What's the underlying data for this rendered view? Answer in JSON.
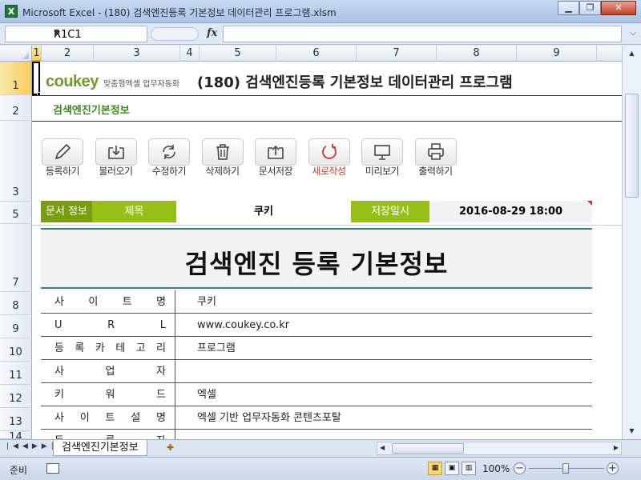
{
  "window": {
    "app_icon": "X",
    "title": "Microsoft Excel - (180) 검색엔진등록 기본정보 데이터관리 프로그램.xlsm",
    "min": "▁",
    "max": "❐",
    "close": "✕"
  },
  "formula": {
    "namebox": "R1C1",
    "fx": "fx",
    "value": ""
  },
  "columns": [
    {
      "label": "1",
      "w": 12
    },
    {
      "label": "2",
      "w": 65
    },
    {
      "label": "3",
      "w": 108
    },
    {
      "label": "4",
      "w": 24
    },
    {
      "label": "5",
      "w": 96
    },
    {
      "label": "6",
      "w": 100
    },
    {
      "label": "7",
      "w": 100
    },
    {
      "label": "8",
      "w": 100
    },
    {
      "label": "9",
      "w": 100
    }
  ],
  "rows": [
    "1",
    "2",
    "3",
    "5",
    "7",
    "8",
    "9",
    "10",
    "11",
    "12",
    "13",
    "14"
  ],
  "header": {
    "logo": "coukey",
    "logo_sub": "맞춤형엑셀 업무자동화",
    "title": "(180) 검색엔진등록 기본정보 데이터관리 프로그램",
    "subtitle": "검색엔진기본정보"
  },
  "toolbar": [
    {
      "name": "register",
      "label": "등록하기",
      "icon": "pencil-icon"
    },
    {
      "name": "load",
      "label": "불러오기",
      "icon": "download-tray-icon"
    },
    {
      "name": "edit",
      "label": "수정하기",
      "icon": "refresh-icon"
    },
    {
      "name": "delete",
      "label": "삭제하기",
      "icon": "trash-icon"
    },
    {
      "name": "save-doc",
      "label": "문서저장",
      "icon": "upload-tray-icon"
    },
    {
      "name": "new",
      "label": "새로작성",
      "icon": "new-circle-icon"
    },
    {
      "name": "preview",
      "label": "미리보기",
      "icon": "monitor-icon"
    },
    {
      "name": "print",
      "label": "출력하기",
      "icon": "printer-icon"
    }
  ],
  "info": {
    "doc_info_label": "문서 정보",
    "title_label": "제목",
    "title_value": "쿠키",
    "saved_label": "저장일시",
    "saved_value": "2016-08-29 18:00"
  },
  "form_title": "검색엔진 등록 기본정보",
  "fields": [
    {
      "label": [
        "사",
        "이",
        "트",
        "명"
      ],
      "value": "쿠키"
    },
    {
      "label": [
        "U",
        "R",
        "L"
      ],
      "value": "www.coukey.co.kr"
    },
    {
      "label": [
        "등",
        "록",
        "카",
        "테",
        "고",
        "리"
      ],
      "value": "프로그램"
    },
    {
      "label": [
        "사",
        "업",
        "자"
      ],
      "value": ""
    },
    {
      "label": [
        "키",
        "워",
        "드"
      ],
      "value": "엑셀"
    },
    {
      "label": [
        "사",
        "이",
        "트",
        "설",
        "명"
      ],
      "value": "엑셀 기반 업무자동화 콘텐츠포탈"
    },
    {
      "label": [
        "등",
        "록",
        "자"
      ],
      "value": ""
    }
  ],
  "sheet_tab": "검색엔진기본정보",
  "status": {
    "ready": "준비",
    "zoom": "100%"
  },
  "colors": {
    "accent_green": "#7a9c10",
    "light_green": "#96c017",
    "teal_border": "#3a7f86",
    "logo_green": "#6e9b2a"
  }
}
